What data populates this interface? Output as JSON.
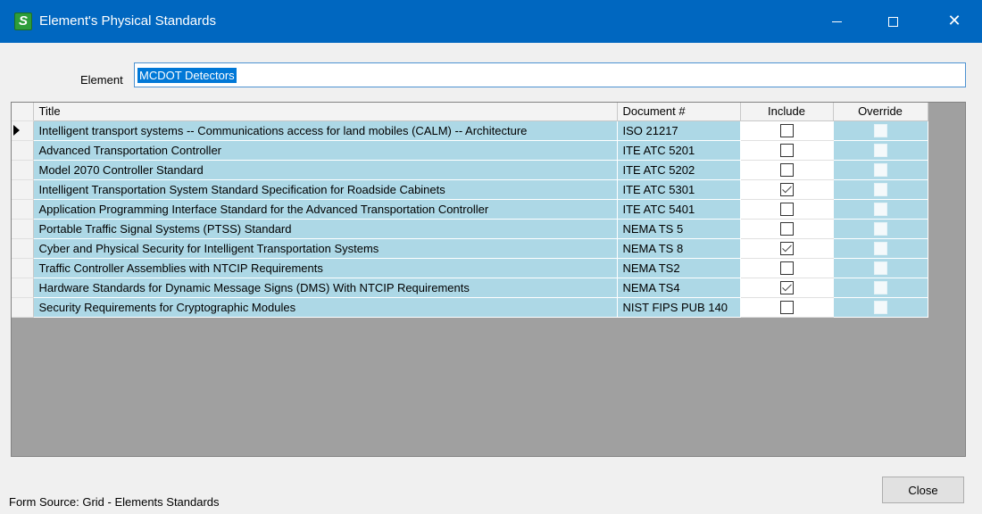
{
  "window": {
    "title": "Element's Physical Standards",
    "app_icon_letter": "S",
    "controls": {
      "minimize": "—",
      "maximize": "□",
      "close": "✕"
    }
  },
  "element": {
    "label": "Element",
    "value": "MCDOT Detectors"
  },
  "grid": {
    "columns": [
      "Title",
      "Document #",
      "Include",
      "Override"
    ],
    "current_row": 0,
    "rows": [
      {
        "title": "Intelligent transport systems -- Communications access for land mobiles (CALM) -- Architecture",
        "document": "ISO 21217",
        "include": false,
        "override": false
      },
      {
        "title": "Advanced Transportation Controller",
        "document": "ITE ATC 5201",
        "include": false,
        "override": false
      },
      {
        "title": "Model 2070 Controller Standard",
        "document": "ITE ATC 5202",
        "include": false,
        "override": false
      },
      {
        "title": "Intelligent Transportation System Standard Specification for Roadside Cabinets",
        "document": "ITE ATC 5301",
        "include": true,
        "override": false
      },
      {
        "title": "Application Programming Interface Standard for the Advanced Transportation Controller",
        "document": "ITE ATC 5401",
        "include": false,
        "override": false
      },
      {
        "title": "Portable Traffic Signal Systems (PTSS) Standard",
        "document": "NEMA TS 5",
        "include": false,
        "override": false
      },
      {
        "title": "Cyber and Physical Security for Intelligent Transportation Systems",
        "document": "NEMA TS 8",
        "include": true,
        "override": false
      },
      {
        "title": "Traffic Controller Assemblies with NTCIP Requirements",
        "document": "NEMA TS2",
        "include": false,
        "override": false
      },
      {
        "title": "Hardware Standards for Dynamic Message Signs (DMS) With NTCIP Requirements",
        "document": "NEMA TS4",
        "include": true,
        "override": false
      },
      {
        "title": "Security Requirements for Cryptographic Modules",
        "document": "NIST FIPS PUB 140",
        "include": false,
        "override": false
      }
    ]
  },
  "footer": {
    "source_text": "Form Source: Grid - Elements Standards",
    "close_label": "Close"
  },
  "colors": {
    "titlebar": "#0067c0",
    "cell": "#add8e6",
    "grid_bg": "#a0a0a0"
  }
}
